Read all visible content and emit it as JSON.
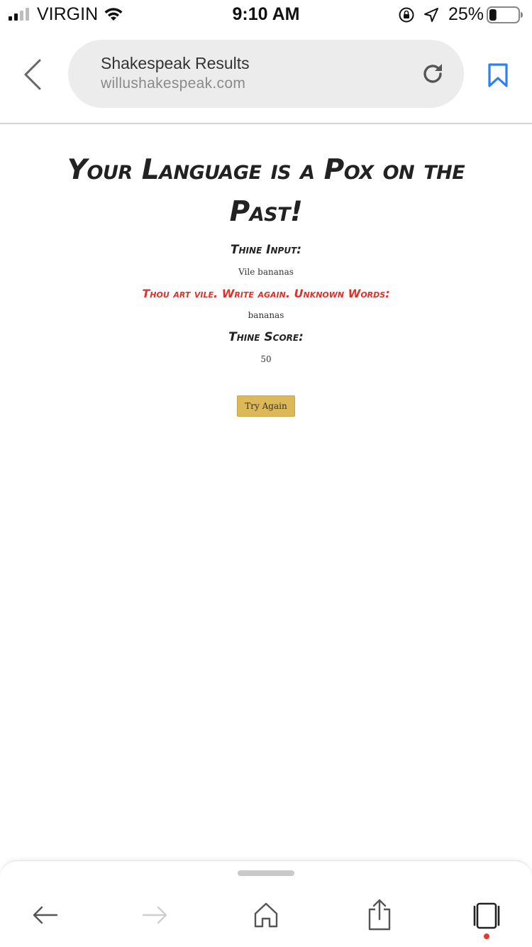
{
  "status_bar": {
    "carrier": "VIRGIN",
    "time": "9:10 AM",
    "battery_percent": "25%",
    "battery_level": 0.25
  },
  "browser": {
    "page_title": "Shakespeak Results",
    "domain": "willushakespeak.com"
  },
  "page": {
    "headline": "Your Language is a Pox on the Past!",
    "input_label": "Thine Input:",
    "input_value": "Vile bananas",
    "error_message": "Thou art vile. Write again. Unknown Words:",
    "unknown_words": "bananas",
    "score_label": "Thine Score:",
    "score_value": "50",
    "try_again_label": "Try Again"
  },
  "colors": {
    "accent_blue": "#2d7ff9",
    "error_red": "#e0302a",
    "button_gold": "#dcb859",
    "notification_dot": "#e53a2e"
  },
  "icons": {
    "status": [
      "signal-icon",
      "wifi-icon",
      "orientation-lock-icon",
      "location-arrow-icon",
      "battery-icon"
    ],
    "browser": [
      "back-chevron-icon",
      "reload-icon",
      "bookmark-icon"
    ],
    "toolbar": [
      "back-arrow-icon",
      "forward-arrow-icon",
      "home-icon",
      "share-icon",
      "tabs-icon"
    ]
  }
}
